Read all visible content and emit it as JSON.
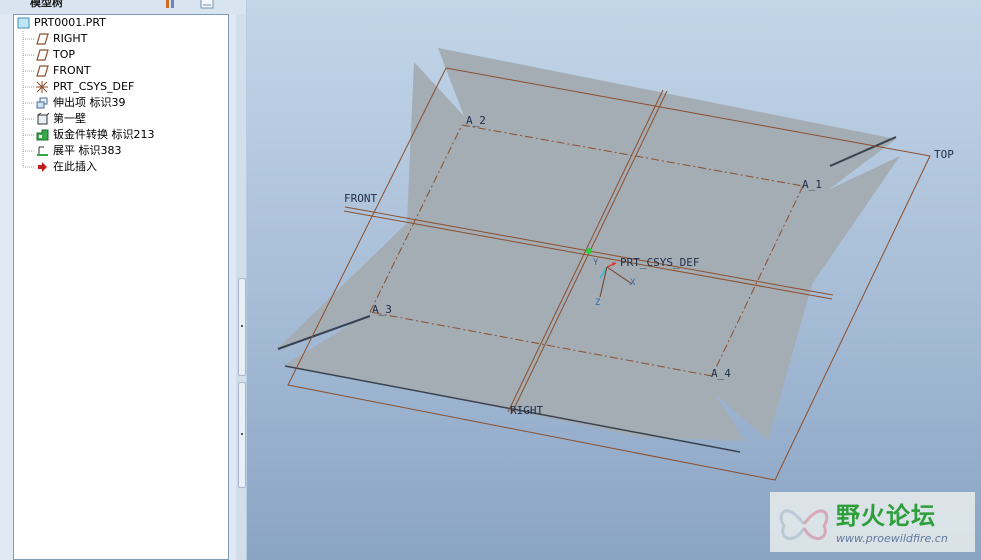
{
  "model_tree": {
    "title": "模型树",
    "items": [
      {
        "label": "PRT0001.PRT",
        "icon": "part-icon"
      },
      {
        "label": "RIGHT",
        "icon": "datum-plane-icon"
      },
      {
        "label": "TOP",
        "icon": "datum-plane-icon"
      },
      {
        "label": "FRONT",
        "icon": "datum-plane-icon"
      },
      {
        "label": "PRT_CSYS_DEF",
        "icon": "csys-icon"
      },
      {
        "label": "伸出项 标识39",
        "icon": "protrusion-icon"
      },
      {
        "label": "第一壁",
        "icon": "first-wall-icon"
      },
      {
        "label": "钣金件转换 标识213",
        "icon": "sheetmetal-conversion-icon"
      },
      {
        "label": "展平 标识383",
        "icon": "flatten-icon"
      },
      {
        "label": "在此插入",
        "icon": "insert-here-arrow-icon"
      }
    ]
  },
  "viewport": {
    "datum_labels": {
      "top": "TOP",
      "front": "FRONT",
      "right": "RIGHT",
      "csys": "PRT_CSYS_DEF",
      "axis_1": "A_1",
      "axis_2": "A_2",
      "axis_3": "A_3",
      "axis_4": "A_4",
      "csys_x": "X",
      "csys_y": "Y",
      "csys_z": "Z"
    }
  },
  "watermark": {
    "title": "野火论坛",
    "url": "www.proewildfire.cn"
  },
  "colors": {
    "datum": "#8c4f2c",
    "surface": "#a4acb4",
    "tree_border": "#7f9db9",
    "watermark_green": "#2e9e3a"
  }
}
